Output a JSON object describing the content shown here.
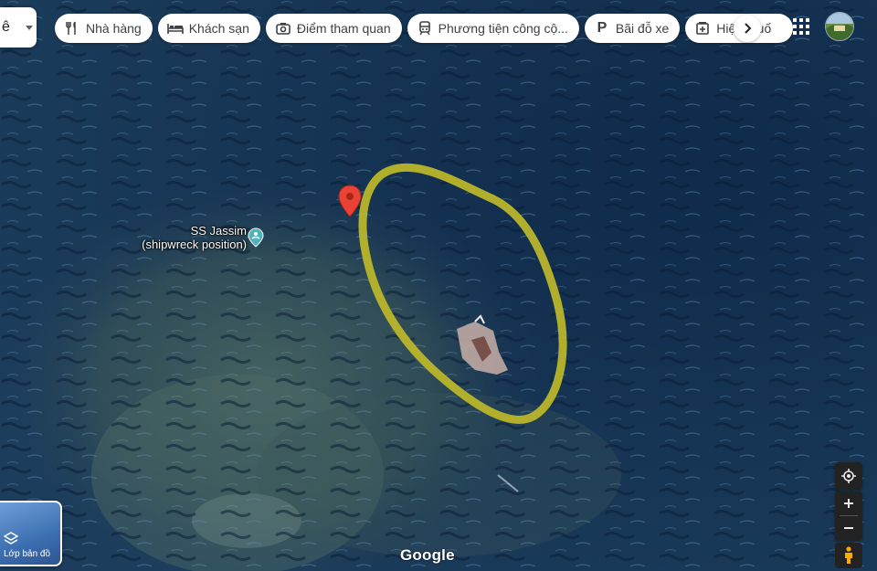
{
  "search": {
    "text": "ê"
  },
  "chips": [
    {
      "label": "Nhà hàng",
      "icon": "fork-knife-icon"
    },
    {
      "label": "Khách sạn",
      "icon": "bed-icon"
    },
    {
      "label": "Điểm tham quan",
      "icon": "camera-icon"
    },
    {
      "label": "Phương tiện công cộ...",
      "icon": "train-icon"
    },
    {
      "label": "Bãi đỗ xe",
      "icon": "parking-icon"
    },
    {
      "label": "Hiệu thuố",
      "icon": "pharmacy-icon"
    }
  ],
  "place": {
    "name_line1": "SS Jassim",
    "name_line2": "(shipwreck position)"
  },
  "layers": {
    "label": "Lớp bản đồ"
  },
  "brand": {
    "label": "Google"
  },
  "colors": {
    "water": "#1a3a5c",
    "reef": "#3e5a5a",
    "annotation": "#b9b52a",
    "pin": "#ea4335",
    "poi": "#4fb3bf"
  }
}
